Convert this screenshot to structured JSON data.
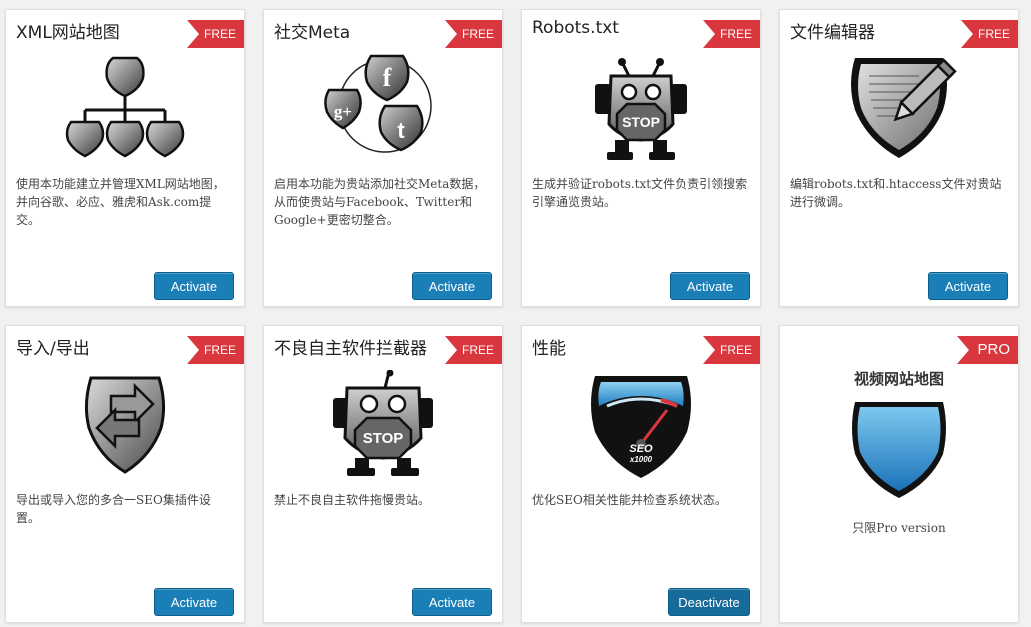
{
  "colors": {
    "ribbon": "#d9363e",
    "button": "#1a7fb7",
    "page_bg": "#f1f1f1",
    "card_bg": "#ffffff"
  },
  "cards": [
    {
      "title": "XML网站地图",
      "badge": "FREE",
      "icon": "sitemap-icon",
      "description": "使用本功能建立并管理XML网站地图，并向谷歌、必应、雅虎和Ask.com提交。",
      "button": "Activate"
    },
    {
      "title": "社交Meta",
      "badge": "FREE",
      "icon": "social-icon",
      "description": "启用本功能为贵站添加社交Meta数据，从而使贵站与Facebook、Twitter和Google+更密切整合。",
      "button": "Activate"
    },
    {
      "title": "Robots.txt",
      "badge": "FREE",
      "icon": "robot-icon",
      "description": "生成并验证robots.txt文件负责引领搜索引擎通览贵站。",
      "button": "Activate"
    },
    {
      "title": "文件编辑器",
      "badge": "FREE",
      "icon": "file-editor-icon",
      "description": "编辑robots.txt和.htaccess文件对贵站进行微调。",
      "button": "Activate"
    },
    {
      "title": "导入/导出",
      "badge": "FREE",
      "icon": "import-export-icon",
      "description": "导出或导入您的多合一SEO集插件设置。",
      "button": "Activate"
    },
    {
      "title": "不良自主软件拦截器",
      "badge": "FREE",
      "icon": "bad-bot-blocker-icon",
      "description": "禁止不良自主软件拖慢贵站。",
      "button": "Activate"
    },
    {
      "title": "性能",
      "badge": "FREE",
      "icon": "performance-icon",
      "gauge_text": "SEO",
      "gauge_sub": "x1000",
      "description": "优化SEO相关性能并检查系统状态。",
      "button": "Deactivate"
    },
    {
      "title": "视频网站地图",
      "badge": "PRO",
      "icon": "video-sitemap-icon",
      "note": "只限Pro version"
    }
  ],
  "robot_sign": "STOP"
}
